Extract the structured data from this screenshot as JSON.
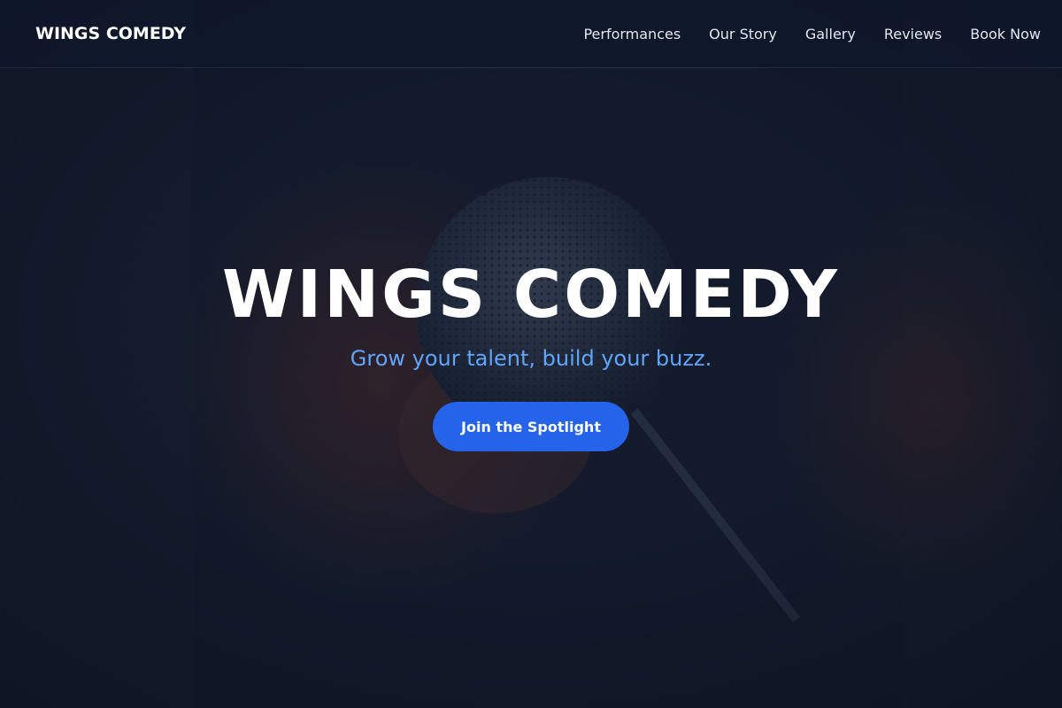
{
  "header": {
    "brand": "WINGS COMEDY",
    "nav": [
      {
        "label": "Performances"
      },
      {
        "label": "Our Story"
      },
      {
        "label": "Gallery"
      },
      {
        "label": "Reviews"
      },
      {
        "label": "Book Now"
      }
    ]
  },
  "hero": {
    "title": "WINGS COMEDY",
    "tagline": "Grow your talent, build your buzz.",
    "cta_label": "Join the Spotlight",
    "background_image": "microphone-photo"
  },
  "colors": {
    "background": "#0f172a",
    "accent": "#2563eb",
    "tagline": "#60a5fa",
    "text": "#ffffff"
  }
}
